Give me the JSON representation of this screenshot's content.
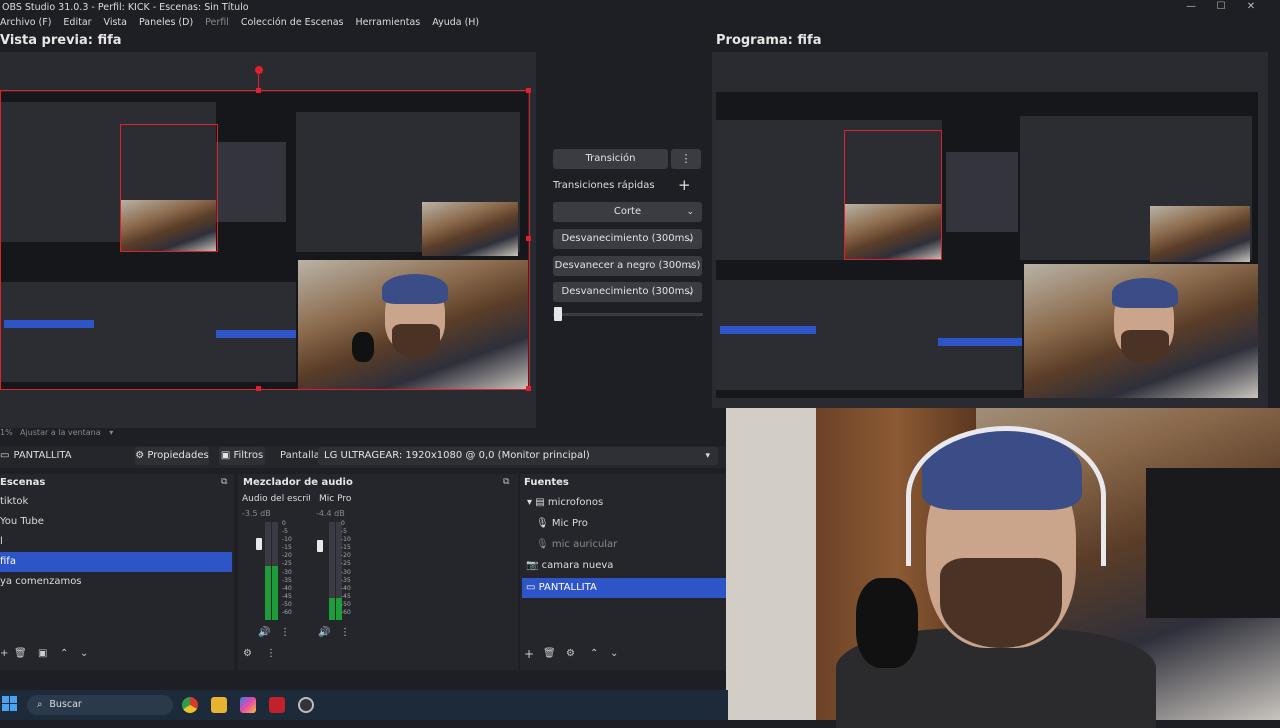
{
  "window": {
    "title": "OBS Studio 31.0.3 - Perfil: KICK - Escenas: Sin Título",
    "controls": {
      "minimize": "—",
      "maximize": "☐",
      "close": "✕"
    }
  },
  "menu": {
    "items": [
      "Archivo (F)",
      "Editar",
      "Vista",
      "Paneles (D)",
      "Perfil",
      "Colección de Escenas",
      "Herramientas",
      "Ayuda (H)"
    ]
  },
  "preview": {
    "title": "Vista previa: fifa"
  },
  "program": {
    "title": "Programa: fifa"
  },
  "transitions": {
    "transition_button": "Transición",
    "quick_label": "Transiciones rápidas",
    "items": [
      "Corte",
      "Desvanecimiento (300ms)",
      "Desvanecer a negro (300ms)",
      "Desvanecimiento (300ms)"
    ]
  },
  "zoom_bar": {
    "zoom": "1%",
    "fit": "Ajustar a la ventana"
  },
  "source_bar": {
    "selected_source": "PANTALLITA",
    "properties": "Propiedades",
    "filters": "Filtros",
    "display_label": "Pantalla",
    "display_value": "LG ULTRAGEAR: 1920x1080 @ 0,0 (Monitor principal)"
  },
  "scenes": {
    "title": "Escenas",
    "items": [
      "tiktok",
      "You Tube",
      "l",
      "fifa",
      "ya comenzamos"
    ],
    "selected_index": 3
  },
  "mixer": {
    "title": "Mezclador de audio",
    "channels": [
      {
        "name": "Audio del escrito",
        "db": "-3.5 dB",
        "level": 0.55
      },
      {
        "name": "Mic Pro",
        "db": "-4.4 dB",
        "level": 0.22
      }
    ],
    "scale": [
      "0",
      "-5",
      "-10",
      "-15",
      "-20",
      "-25",
      "-30",
      "-35",
      "-40",
      "-45",
      "-50",
      "-60"
    ]
  },
  "sources": {
    "title": "Fuentes",
    "group": "microfonos",
    "children": [
      "Mic Pro",
      "mic auricular"
    ],
    "items": [
      "camara nueva",
      "PANTALLITA"
    ],
    "selected": "PANTALLITA"
  },
  "taskbar": {
    "search_placeholder": "Buscar"
  },
  "colors": {
    "accent": "#2e55c8",
    "bounds": "#e0202a",
    "panel": "#2a2b31",
    "background": "#1e1f24"
  }
}
